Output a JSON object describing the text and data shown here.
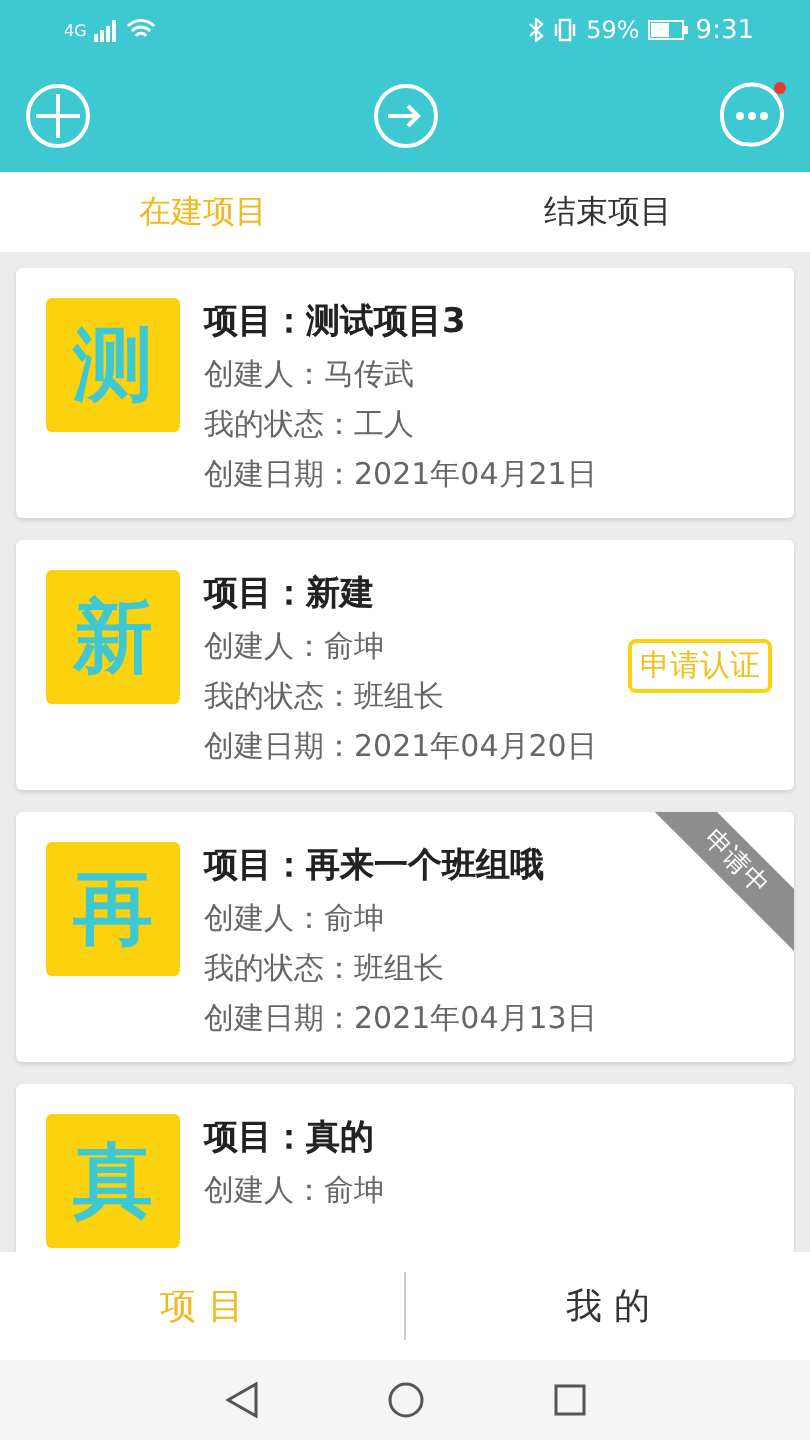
{
  "status_bar": {
    "network": "4G",
    "battery": "59%",
    "time": "9:31"
  },
  "header": {
    "has_notification": true
  },
  "tabs": [
    {
      "label": "在建项目",
      "selected": true
    },
    {
      "label": "结束项目",
      "selected": false
    }
  ],
  "projects": [
    {
      "badge": "测",
      "title": "项目：测试项目3",
      "lines": [
        "创建人：马传武",
        "我的状态：工人",
        "创建日期：2021年04月21日"
      ]
    },
    {
      "badge": "新",
      "title": "项目：新建",
      "lines": [
        "创建人：俞坤",
        "我的状态：班组长",
        "创建日期：2021年04月20日"
      ],
      "action": "申请认证"
    },
    {
      "badge": "再",
      "title": "项目：再来一个班组哦",
      "lines": [
        "创建人：俞坤",
        "我的状态：班组长",
        "创建日期：2021年04月13日"
      ],
      "ribbon": "申请中"
    },
    {
      "badge": "真",
      "title": "项目：真的",
      "lines": [
        "创建人：俞坤"
      ]
    }
  ],
  "bottom_tabs": [
    {
      "label": "项 目",
      "selected": true
    },
    {
      "label": "我 的",
      "selected": false
    }
  ]
}
